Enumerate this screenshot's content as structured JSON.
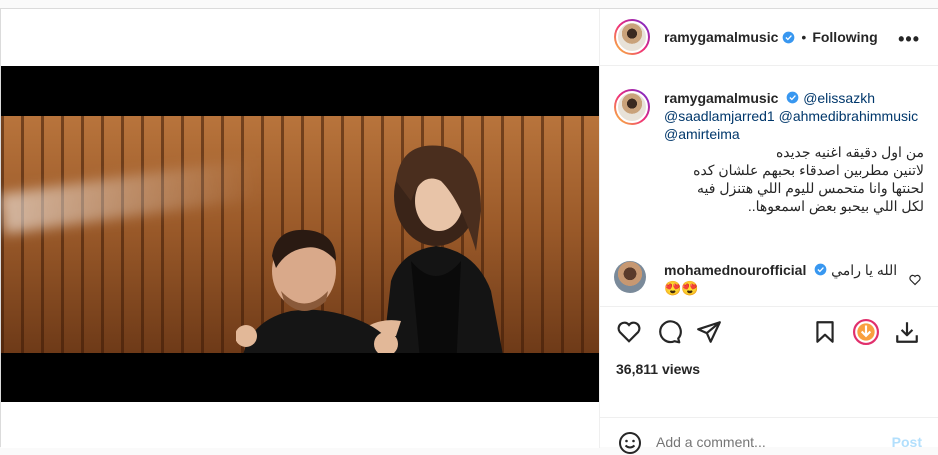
{
  "header": {
    "username": "ramygamalmusic",
    "separator": "•",
    "following_label": "Following",
    "more_label": "•••"
  },
  "caption": {
    "username": "ramygamalmusic",
    "mention1": "@elissazkh",
    "mention2": "@saadlamjarred1",
    "mention3": "@ahmedibrahimmusic",
    "mention4": "@amirteima",
    "line1": "من اول دقيقه اغنيه جديده",
    "line2": "لاتنين مطربين اصدقاء بحبهم علشان كده",
    "line3": "لحنتها وانا متحمس لليوم اللي هتنزل فيه",
    "line4": "لكل اللي بيحبو بعض اسمعوها.."
  },
  "comment": {
    "username": "mohamednourofficial",
    "text": "الله يا رامي",
    "emojis": "😍😍"
  },
  "stats": {
    "views": "36,811 views"
  },
  "add_comment": {
    "placeholder": "Add a comment...",
    "post_label": "Post"
  },
  "colors": {
    "verified": "#3897f0",
    "link": "#00376b",
    "post_disabled": "#b2dffc",
    "download_accent": "#e1306c"
  },
  "icons": [
    "verified-badge-icon",
    "heart-icon",
    "comment-icon",
    "share-icon",
    "bookmark-icon",
    "download-icon",
    "save-icon",
    "emoji-icon"
  ]
}
